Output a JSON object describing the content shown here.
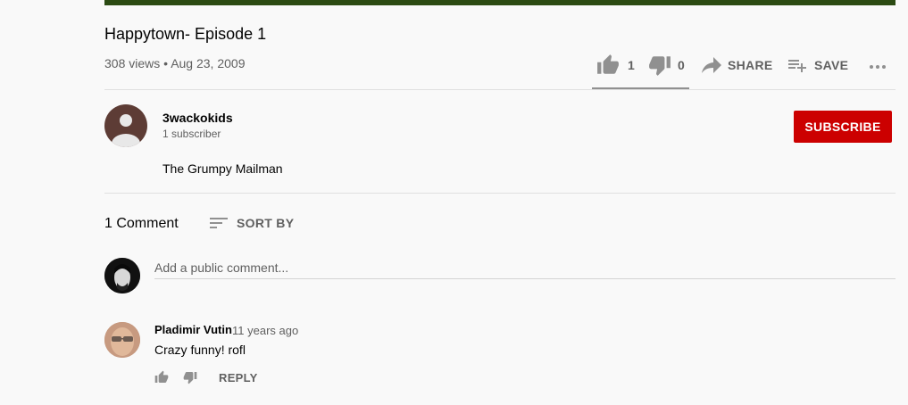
{
  "video": {
    "title": "Happytown- Episode 1",
    "views": "308 views",
    "separator": "•",
    "date": "Aug 23, 2009"
  },
  "actions": {
    "like_count": "1",
    "dislike_count": "0",
    "share_label": "SHARE",
    "save_label": "SAVE"
  },
  "channel": {
    "name": "3wackokids",
    "subscribers": "1 subscriber",
    "subscribe_label": "SUBSCRIBE",
    "description": "The Grumpy Mailman"
  },
  "comments": {
    "count_label": "1 Comment",
    "sort_label": "SORT BY",
    "input_placeholder": "Add a public comment...",
    "items": [
      {
        "author": "Pladimir Vutin",
        "time": "11 years ago",
        "text": "Crazy funny!  rofl",
        "reply_label": "REPLY"
      }
    ]
  },
  "colors": {
    "subscribe_bg": "#cc0000",
    "video_bar": "#2c4b13",
    "secondary_text": "#606060"
  }
}
